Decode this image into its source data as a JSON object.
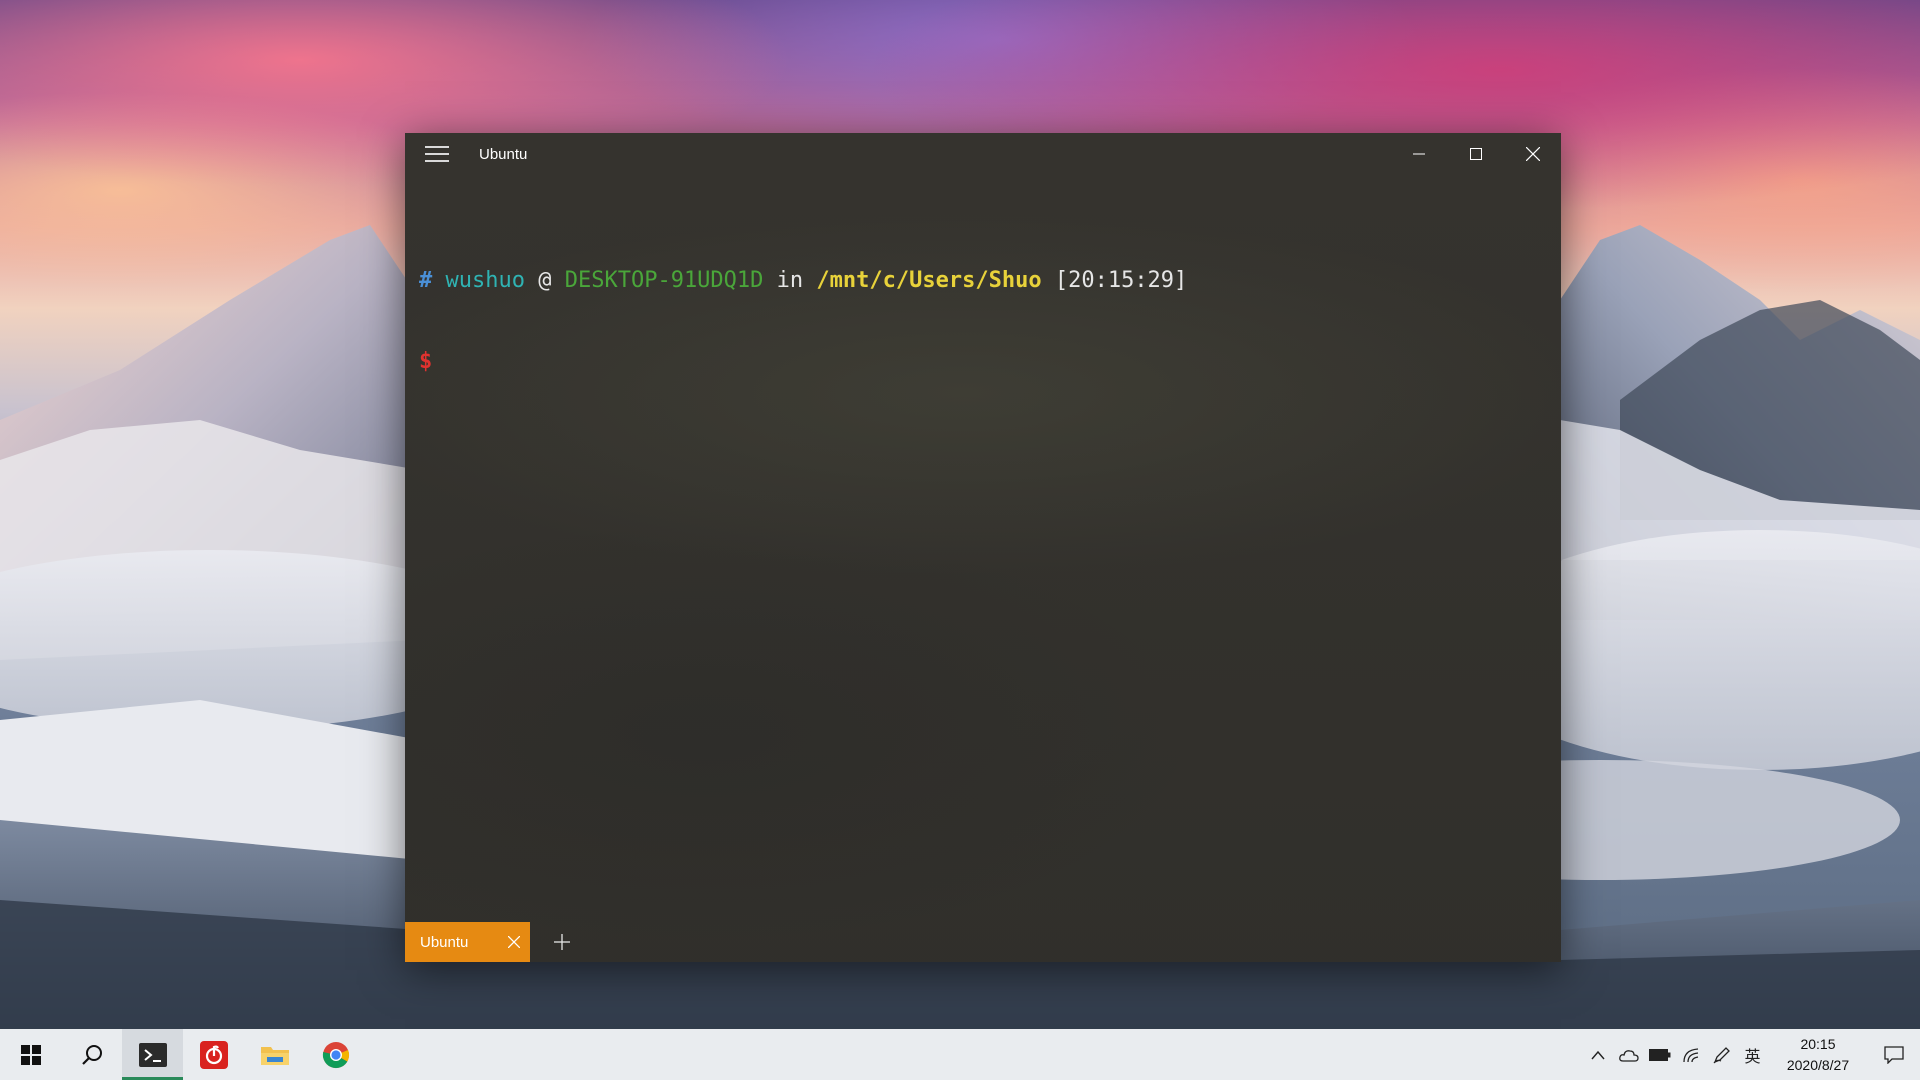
{
  "window": {
    "title": "Ubuntu"
  },
  "terminal": {
    "prompt_hash": "#",
    "user": "wushuo",
    "at": "@",
    "host": "DESKTOP-91UDQ1D",
    "in": "in",
    "path": "/mnt/c/Users/Shuo",
    "time": "[20:15:29]",
    "dollar": "$"
  },
  "tabs": [
    {
      "label": "Ubuntu",
      "active": true,
      "color": "#e68a12"
    }
  ],
  "taskbar": {
    "pinned": [
      {
        "name": "start",
        "icon": "windows-logo-icon"
      },
      {
        "name": "search",
        "icon": "search-icon"
      },
      {
        "name": "terminal",
        "icon": "terminal-icon",
        "active": true
      },
      {
        "name": "netease-music",
        "icon": "netease-music-icon"
      },
      {
        "name": "file-explorer",
        "icon": "folder-icon"
      },
      {
        "name": "chrome",
        "icon": "chrome-icon"
      }
    ],
    "tray": {
      "icons": [
        "chevron-up-icon",
        "onedrive-icon",
        "battery-icon",
        "wifi-icon",
        "pen-icon"
      ],
      "ime": "英",
      "time": "20:15",
      "date": "2020/8/27"
    }
  },
  "colors": {
    "accent_tab": "#e68a12",
    "taskbar_active": "#2a8a5a"
  }
}
